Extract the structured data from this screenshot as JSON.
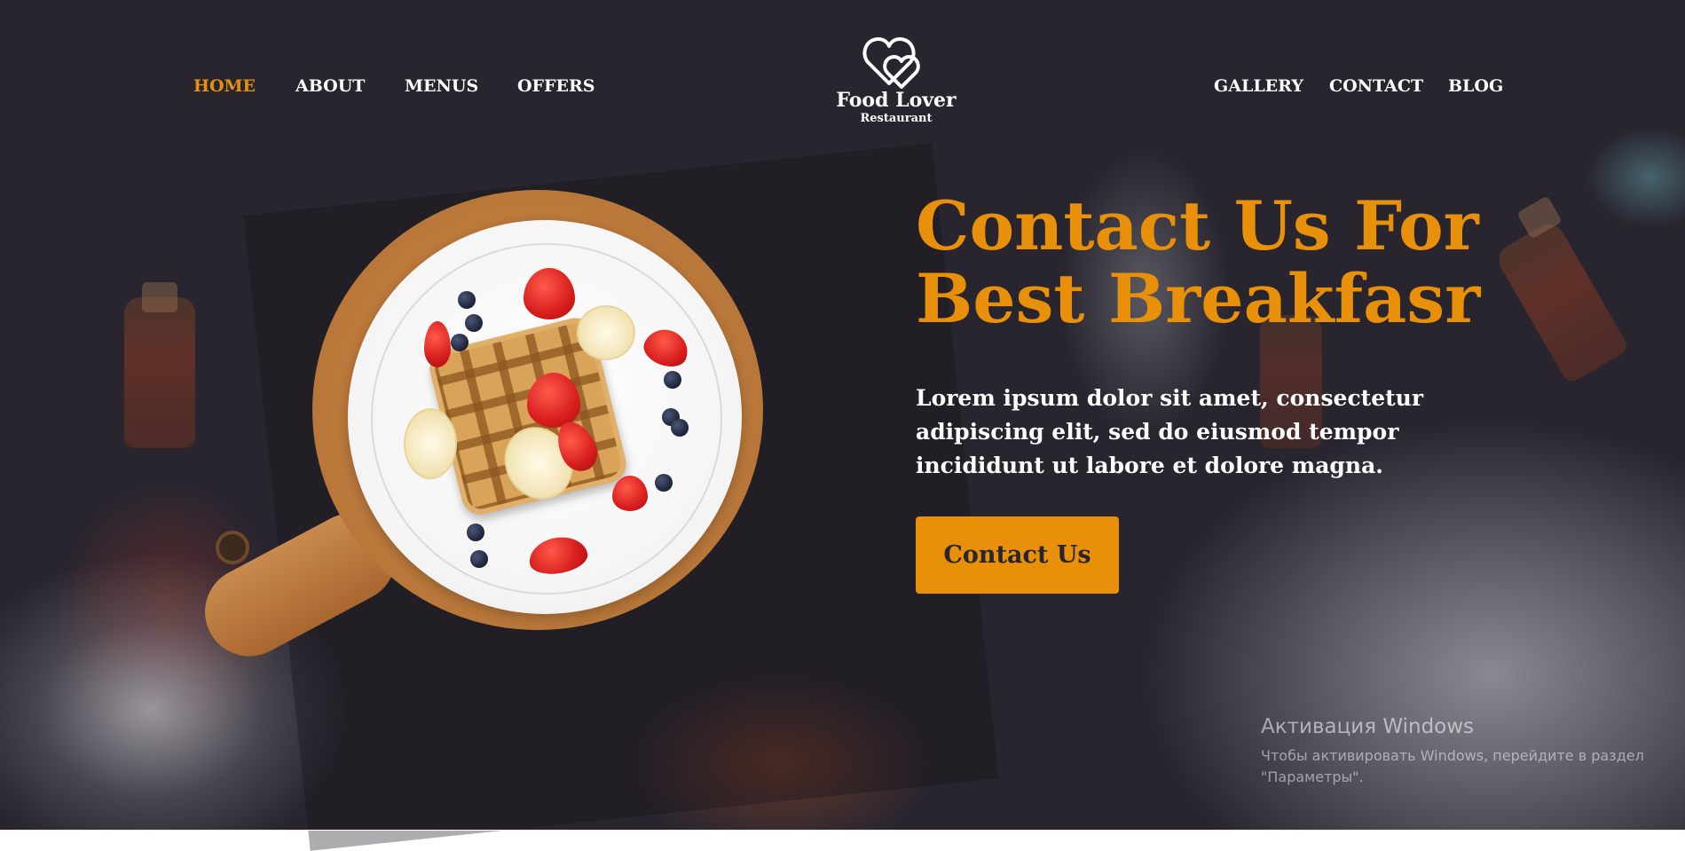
{
  "nav": {
    "left": [
      {
        "label": "HOME",
        "active": true
      },
      {
        "label": "ABOUT",
        "active": false
      },
      {
        "label": "MENUS",
        "active": false
      },
      {
        "label": "OFFERS",
        "active": false
      }
    ],
    "right": [
      {
        "label": "GALLERY"
      },
      {
        "label": "CONTACT"
      },
      {
        "label": "BLOG"
      }
    ]
  },
  "logo": {
    "icon": "double-heart-icon",
    "name": "Food Lover",
    "subtitle": "Restaurant"
  },
  "hero": {
    "title_line1": "Contact Us For",
    "title_line2": "Best Breakfasr",
    "description": "Lorem ipsum dolor sit amet, consectetur adipiscing elit, sed do eiusmod tempor incididunt ut labore et dolore magna.",
    "cta_label": "Contact Us",
    "image": "waffle-breakfast-plate-image"
  },
  "windows_watermark": {
    "title": "Активация Windows",
    "subtitle": "Чтобы активировать Windows, перейдите в раздел \"Параметры\"."
  },
  "colors": {
    "background": "#28252f",
    "accent": "#e8900a",
    "text": "#ffffff"
  }
}
